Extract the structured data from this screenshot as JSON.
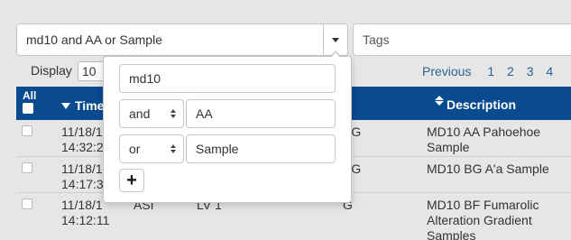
{
  "search": {
    "query": "md10 and AA or Sample"
  },
  "tags": {
    "placeholder": "Tags"
  },
  "display": {
    "label": "Display",
    "page_size": "10"
  },
  "pagination": {
    "previous": "Previous",
    "pages": [
      "1",
      "2",
      "3",
      "4"
    ]
  },
  "table": {
    "header": {
      "all": "All",
      "time": "Time",
      "description": "Description"
    },
    "rows": [
      {
        "time_line1": "11/18/1",
        "time_line2": "14:32:2",
        "frag": "PG",
        "description": "MD10 AA Pahoehoe Sample"
      },
      {
        "time_line1": "11/18/1",
        "time_line2": "14:17:3",
        "frag": "PG",
        "description": "MD10 BG A'a Sample"
      },
      {
        "time_line1": "11/18/1",
        "time_line2": "14:12:11",
        "frag_a": "ASI",
        "frag_b": "LV 1",
        "frag": "G",
        "description": "MD10 BF Fumarolic Alteration Gradient Samples"
      }
    ]
  },
  "query_builder": {
    "term1": "md10",
    "op1": "and",
    "term2": "AA",
    "op2": "or",
    "term3": "Sample",
    "add_label": "+"
  },
  "colors": {
    "header_bg": "#0a4a8e",
    "link": "#2a6496",
    "page_bg": "#e6e6e6"
  }
}
